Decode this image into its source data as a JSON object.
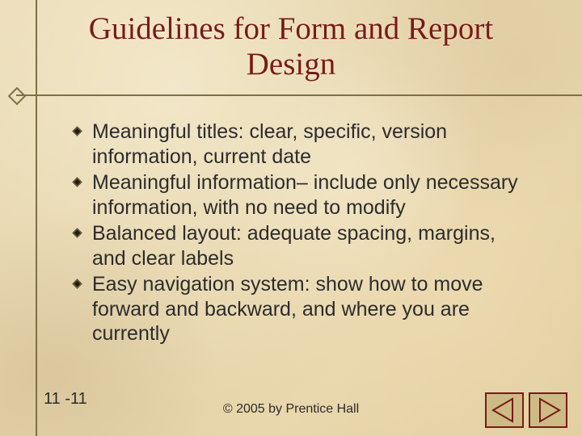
{
  "title": "Guidelines for Form and Report Design",
  "bullets": [
    "Meaningful titles: clear, specific, version information, current date",
    "Meaningful information– include only necessary information, with no need to modify",
    "Balanced layout: adequate spacing, margins, and clear labels",
    "Easy navigation system: show how to move forward and backward, and where you are currently"
  ],
  "page_number": "11 -11",
  "copyright": "© 2005 by Prentice Hall",
  "icons": {
    "bullet": "diamond-bullet-icon",
    "prev": "arrow-left-icon",
    "next": "arrow-right-icon"
  },
  "colors": {
    "title": "#7a1a16",
    "rule": "#7e7046",
    "nav_border": "#7a1a16",
    "nav_fill": "#c9b77f"
  }
}
